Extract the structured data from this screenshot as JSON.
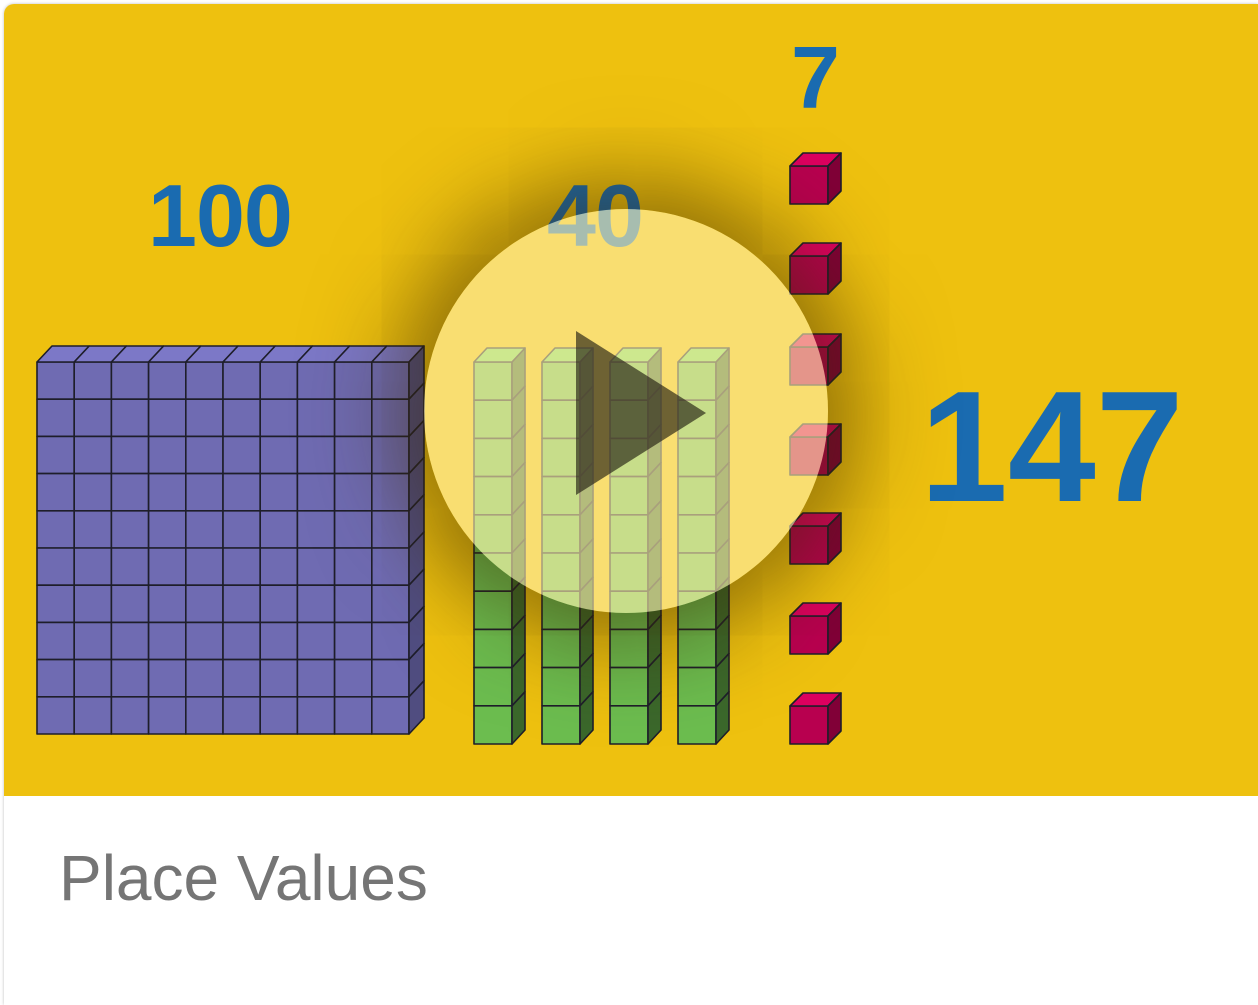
{
  "video": {
    "labels": {
      "hundreds": "100",
      "tens": "40",
      "ones": "7",
      "total": "147"
    },
    "blocks": {
      "hundreds_count": 1,
      "tens_count": 4,
      "ones_count": 7
    },
    "colors": {
      "background": "#eec10f",
      "number_text": "#1a6bb0",
      "hundreds_block": "#6f6bb2",
      "tens_block": "#6cbd4f",
      "ones_block": "#b8004f"
    }
  },
  "card": {
    "title": "Place Values"
  }
}
